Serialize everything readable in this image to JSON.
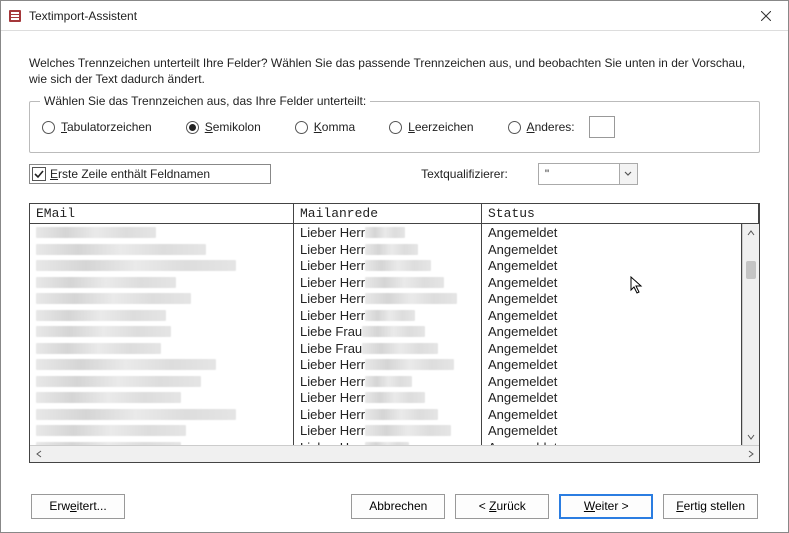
{
  "window": {
    "title": "Textimport-Assistent"
  },
  "intro": "Welches Trennzeichen unterteilt Ihre Felder? Wählen Sie das passende Trennzeichen aus, und beobachten Sie unten in der Vorschau, wie sich der Text dadurch ändert.",
  "delimiter": {
    "legend": "Wählen Sie das Trennzeichen aus, das Ihre Felder unterteilt:",
    "options": {
      "tab": "Tabulatorzeichen",
      "semicolon": "Semikolon",
      "comma": "Komma",
      "space": "Leerzeichen",
      "other": "Anderes:"
    },
    "selected": "semicolon",
    "other_value": ""
  },
  "first_row_fieldnames": {
    "label": "Erste Zeile enthält Feldnamen",
    "checked": true
  },
  "text_qualifier": {
    "label": "Textqualifizierer:",
    "value": "\""
  },
  "grid": {
    "headers": {
      "email": "EMail",
      "anrede": "Mailanrede",
      "status": "Status"
    },
    "rows": [
      {
        "anrede": "Lieber Herr",
        "status": "Angemeldet"
      },
      {
        "anrede": "Lieber Herr",
        "status": "Angemeldet"
      },
      {
        "anrede": "Lieber Herr",
        "status": "Angemeldet"
      },
      {
        "anrede": "Lieber Herr",
        "status": "Angemeldet"
      },
      {
        "anrede": "Lieber Herr",
        "status": "Angemeldet"
      },
      {
        "anrede": "Lieber Herr",
        "status": "Angemeldet"
      },
      {
        "anrede": "Liebe Frau",
        "status": "Angemeldet"
      },
      {
        "anrede": "Liebe Frau",
        "status": "Angemeldet"
      },
      {
        "anrede": "Lieber Herr",
        "status": "Angemeldet"
      },
      {
        "anrede": "Lieber Herr",
        "status": "Angemeldet"
      },
      {
        "anrede": "Lieber Herr",
        "status": "Angemeldet"
      },
      {
        "anrede": "Lieber Herr",
        "status": "Angemeldet"
      },
      {
        "anrede": "Lieber Herr",
        "status": "Angemeldet"
      },
      {
        "anrede": "Lieber Herr",
        "status": "Angemeldet"
      }
    ]
  },
  "buttons": {
    "advanced": "Erweitert...",
    "cancel": "Abbrechen",
    "back": "< Zurück",
    "next": "Weiter >",
    "finish": "Fertig stellen"
  }
}
